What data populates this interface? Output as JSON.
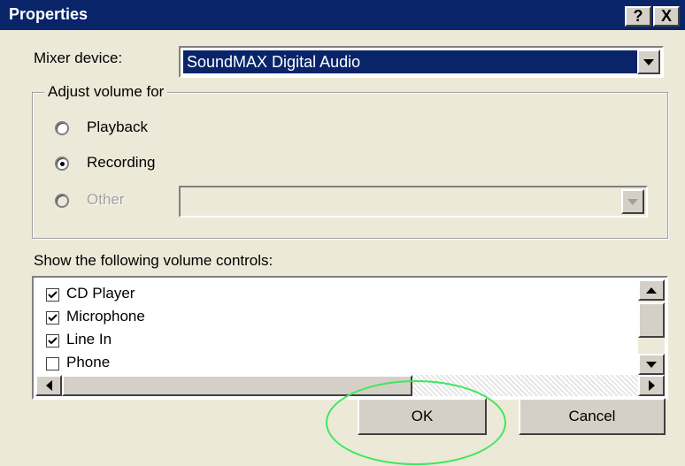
{
  "window": {
    "title": "Properties",
    "help_label": "?",
    "close_label": "X"
  },
  "mixer": {
    "label": "Mixer device:",
    "selected_value": "SoundMAX Digital Audio"
  },
  "adjust_volume": {
    "legend": "Adjust volume for",
    "options": [
      {
        "label": "Playback",
        "selected": false,
        "enabled": true
      },
      {
        "label": "Recording",
        "selected": true,
        "enabled": true
      },
      {
        "label": "Other",
        "selected": false,
        "enabled": false
      }
    ],
    "other_select_value": ""
  },
  "controls": {
    "label": "Show the following volume controls:",
    "items": [
      {
        "label": "CD Player",
        "checked": true
      },
      {
        "label": "Microphone",
        "checked": true
      },
      {
        "label": "Line In",
        "checked": true
      },
      {
        "label": "Phone",
        "checked": false
      }
    ]
  },
  "buttons": {
    "ok": "OK",
    "cancel": "Cancel"
  },
  "colors": {
    "titlebar": "#0A246A",
    "dialog_bg": "#ECE9D8",
    "highlight_ring": "#3DE85A"
  }
}
